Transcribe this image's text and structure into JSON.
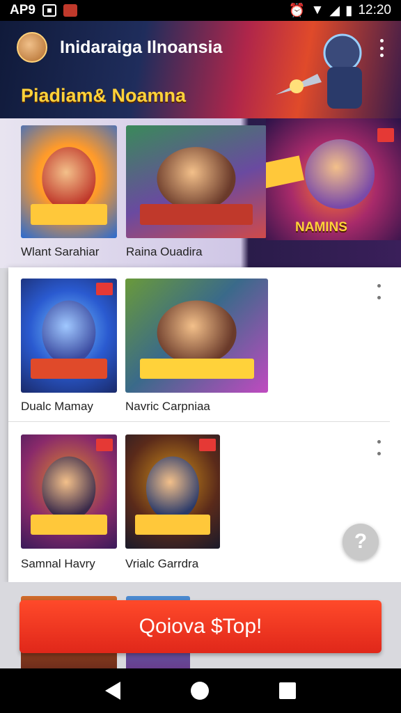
{
  "status_bar": {
    "carrier": "AP9",
    "time": "12:20"
  },
  "header": {
    "title": "Inidaraiga Ilnoansia",
    "banner_text": "Piadiam& Noamna"
  },
  "featured": [
    {
      "label": "Wlant Sarahiar",
      "color_a": "#ff9a2a",
      "color_b": "#2a6ad0"
    },
    {
      "label": "Raina Ouadira",
      "color_a": "#3a8a5a",
      "color_b": "#d04a4a"
    }
  ],
  "promo": {
    "label": "NAMINS"
  },
  "panel": {
    "rows": [
      {
        "items": [
          {
            "label": "Dualc Mamay",
            "color_a": "#2a5ad0",
            "color_b": "#e04a2a"
          },
          {
            "label": "Navric Carpniaa",
            "color_a": "#6a9a3a",
            "color_b": "#c04ac0"
          }
        ]
      },
      {
        "items": [
          {
            "label": "Samnal Havry",
            "color_a": "#6a2a9a",
            "color_b": "#e08a2a"
          },
          {
            "label": "Vrialc Garrdra",
            "color_a": "#2a2a3a",
            "color_b": "#d0901a"
          }
        ]
      }
    ]
  },
  "fab": {
    "symbol": "?"
  },
  "cta": {
    "label": "Qoiova $Top!"
  }
}
